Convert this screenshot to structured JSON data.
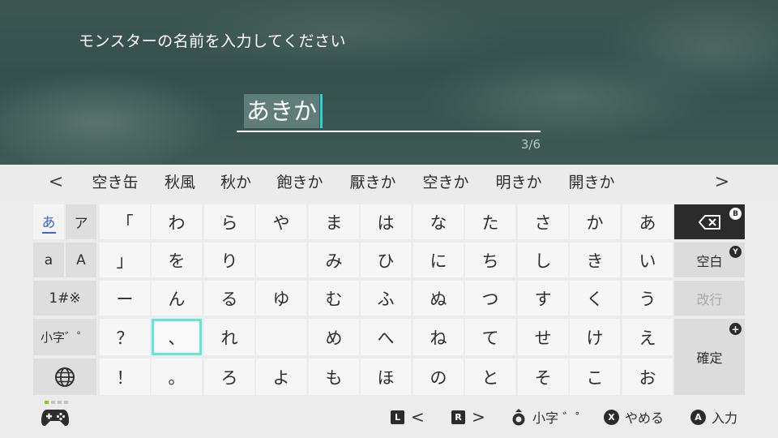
{
  "prompt": "モンスターの名前を入力してください",
  "input": {
    "value": "あきか",
    "count": "3/6"
  },
  "suggestions": {
    "prev": "<",
    "next": ">",
    "items": [
      "空き缶",
      "秋風",
      "秋か",
      "飽きか",
      "厭きか",
      "空きか",
      "明きか",
      "開きか"
    ]
  },
  "modes": {
    "hiragana": "あ",
    "katakana": "ア",
    "alpha_lower": "a",
    "alpha_upper": "A",
    "symbols": "1#※",
    "small_kana": "小字゛゜"
  },
  "grid": [
    [
      "「",
      "わ",
      "ら",
      "や",
      "ま",
      "は",
      "な",
      "た",
      "さ",
      "か",
      "あ"
    ],
    [
      "」",
      "を",
      "り",
      "",
      "み",
      "ひ",
      "に",
      "ち",
      "し",
      "き",
      "い"
    ],
    [
      "ー",
      "ん",
      "る",
      "ゆ",
      "む",
      "ふ",
      "ぬ",
      "つ",
      "す",
      "く",
      "う"
    ],
    [
      "？",
      "、",
      "れ",
      "",
      "め",
      "へ",
      "ね",
      "て",
      "せ",
      "け",
      "え"
    ],
    [
      "！",
      "。",
      "ろ",
      "よ",
      "も",
      "ほ",
      "の",
      "と",
      "そ",
      "こ",
      "お"
    ]
  ],
  "side": {
    "backspace_badge": "B",
    "space": "空白",
    "space_badge": "Y",
    "newline": "改行",
    "confirm": "確定",
    "confirm_badge": "+"
  },
  "footer": {
    "l_badge": "L",
    "l_label": "<",
    "r_badge": "R",
    "r_label": ">",
    "stick_label": "小字 ゛゜",
    "x_badge": "X",
    "x_label": "やめる",
    "a_badge": "A",
    "a_label": "入力"
  },
  "colors": {
    "accent": "#5fe8d9",
    "caret": "#2bd1d4",
    "mode_active": "#3a64d8",
    "indicator_on": "#7ed321"
  }
}
